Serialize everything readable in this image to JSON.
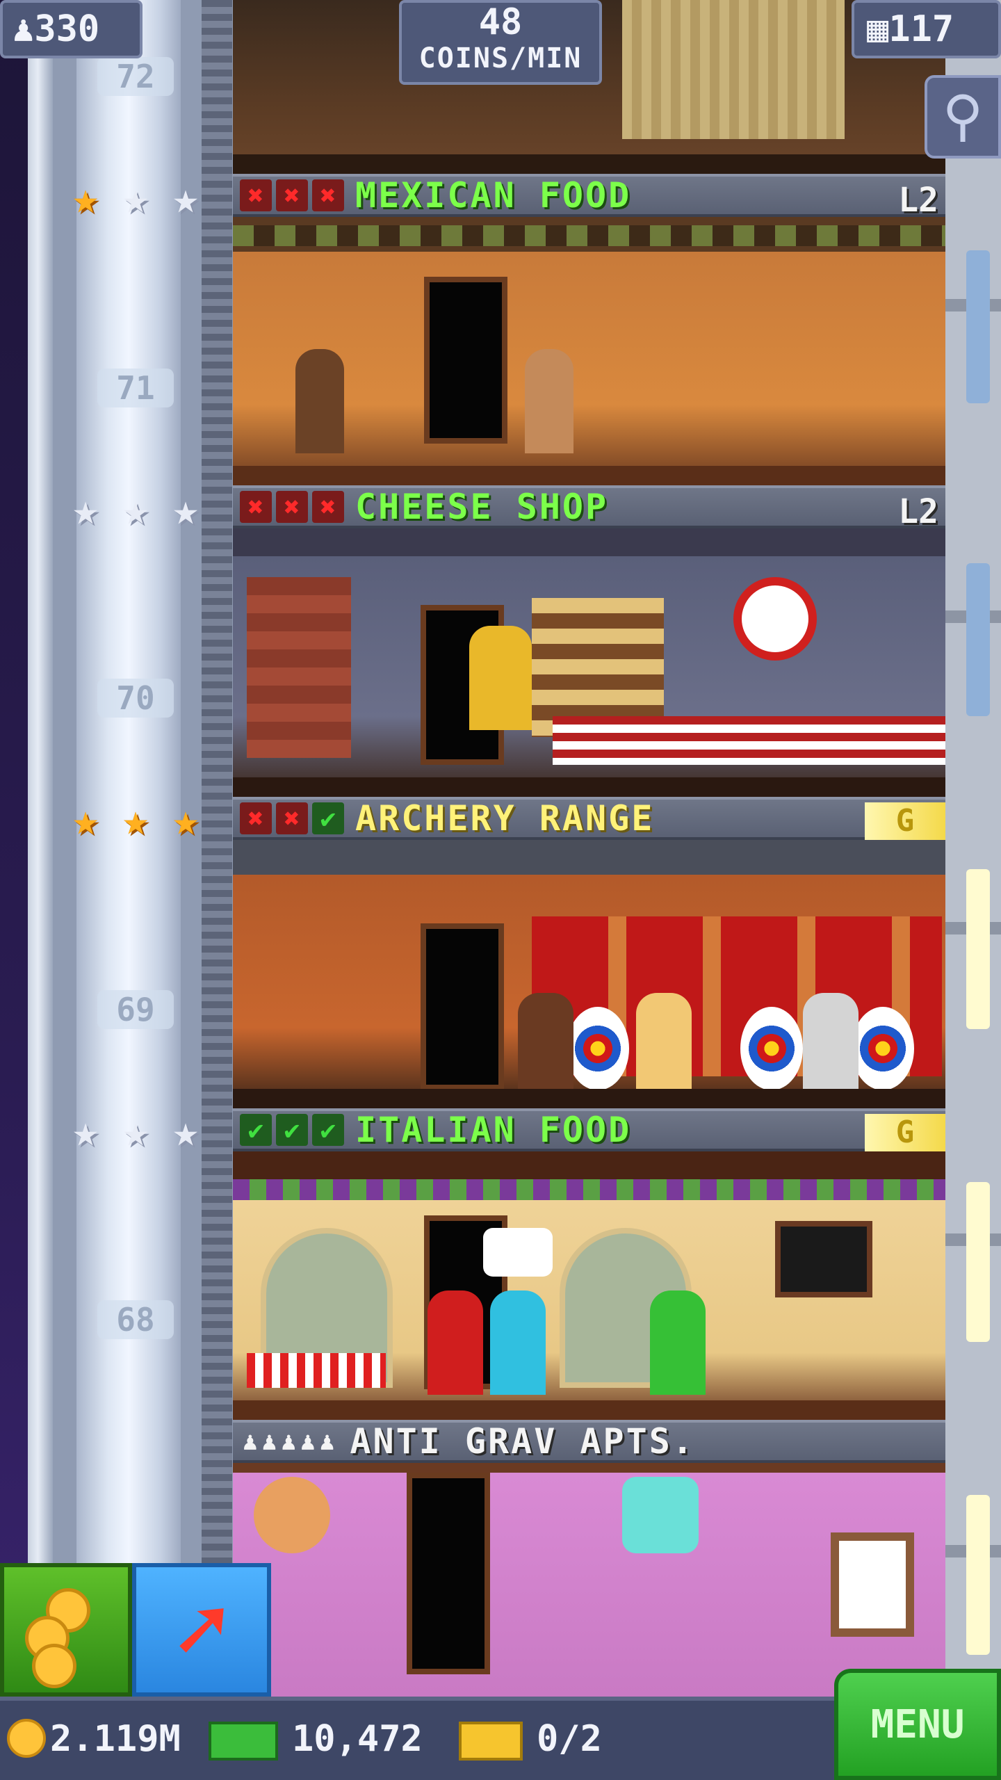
{
  "hud": {
    "population": "330",
    "coins_per_min_value": "48",
    "coins_per_min_label": "COINS/MIN",
    "floor_count": "117"
  },
  "shaft": {
    "floor_numbers": [
      "72",
      "71",
      "70",
      "69",
      "68"
    ]
  },
  "floors": [
    {
      "name": "MEXICAN FOOD",
      "level": "L2",
      "stars": [
        "gold",
        "silver",
        "silver"
      ],
      "marks": [
        "x",
        "x",
        "x"
      ]
    },
    {
      "name": "CHEESE SHOP",
      "level": "L2",
      "stars": [
        "silver",
        "silver",
        "silver"
      ],
      "marks": [
        "x",
        "x",
        "x"
      ]
    },
    {
      "name": "ARCHERY RANGE",
      "badge": "G",
      "stars": [
        "gold",
        "gold",
        "gold"
      ],
      "marks": [
        "x",
        "x",
        "ok"
      ]
    },
    {
      "name": "ITALIAN FOOD",
      "badge": "G",
      "stars": [
        "silver",
        "silver",
        "silver"
      ],
      "marks": [
        "ok",
        "ok",
        "ok"
      ]
    },
    {
      "name": "ANTI GRAV APTS.",
      "residents": "♟♟♟♟♟"
    }
  ],
  "bottom": {
    "coins": "2.119M",
    "bux": "10,472",
    "tickets": "0/2",
    "menu_label": "MENU"
  },
  "icons": {
    "population": "person-icon",
    "floors": "building-icon",
    "search": "magnifier-icon",
    "bux_shop": "coins-icon",
    "build": "arrow-up-icon"
  }
}
